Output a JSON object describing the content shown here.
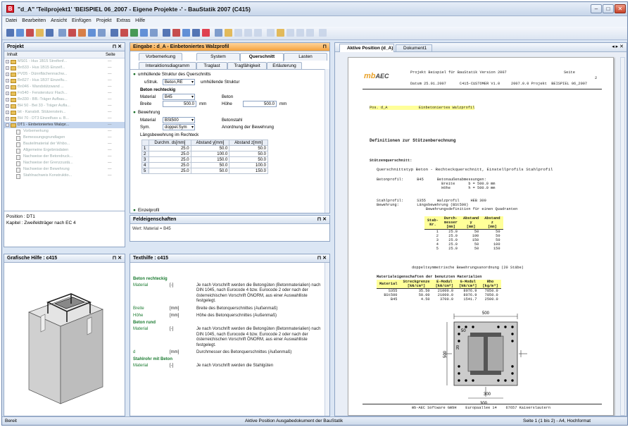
{
  "window": {
    "title": "\"d_A\" 'Teilprojekt1' 'BEISPIEL 06_2007 - Eigene Projekte -' - BauStatik 2007 (C415)",
    "icon": "B"
  },
  "menu": [
    "Datei",
    "Bearbeiten",
    "Ansicht",
    "Einfügen",
    "Projekt",
    "Extras",
    "Hilfe"
  ],
  "project": {
    "title": "Projekt",
    "col_name": "Inhalt",
    "col_page": "Seite",
    "items": [
      {
        "text": "MS01 - Hus 1B15 Streifenf...",
        "level": 0
      },
      {
        "text": "Bn533 - Hus 1B15 Einzelf...",
        "level": 0
      },
      {
        "text": "PVD5 - Dünnflächennachw...",
        "level": 0
      },
      {
        "text": "Bn527 - Hus 1B37 Einzelfu...",
        "level": 0
      },
      {
        "text": "Bn046 - Wandstützwand ...",
        "level": 0
      },
      {
        "text": "Fn540 - Fenstersturz Flach...",
        "level": 0
      },
      {
        "text": "Bn330 - BB.-Träger Aufbau...",
        "level": 0
      },
      {
        "text": "BH 50 - Bei 33 - Träger Aufla...",
        "level": 0
      },
      {
        "text": "bit - Kanalstt. Stützenstein...",
        "level": 0
      },
      {
        "text": "BH 70 - DT3 Einzelfuss u. B...",
        "level": 0
      },
      {
        "text": "DT1 - Einbetoniertes Walzpr...",
        "level": 0
      },
      {
        "text": "Vorbemerkung",
        "level": 1
      },
      {
        "text": "Bemessungsgrundlagen",
        "level": 1
      },
      {
        "text": "Bauteilmaterial der Wnbo...",
        "level": 1
      },
      {
        "text": "Allgemeine Ergebnisdaten",
        "level": 1
      },
      {
        "text": "Nachweise der Betondruck...",
        "level": 1
      },
      {
        "text": "Nachweise der Grenzzustä...",
        "level": 1
      },
      {
        "text": "Nachweise der Bewehrung",
        "level": 1
      },
      {
        "text": "Stahlnachweis Konstruktio...",
        "level": 1
      }
    ],
    "position_lbl": "Position : DT1",
    "kapitel_lbl": "Kapitel : Zweifeldträger nach EC 4"
  },
  "grafische": {
    "title": "Grafische Hilfe : c415"
  },
  "eingabe": {
    "title": "Eingabe : d_A - Einbetoniertes Walzprofil",
    "tabs_top": [
      "Vorbemerkung",
      "System",
      "Querschnitt",
      "Lasten"
    ],
    "tabs_bottom": [
      "Interaktionsdiagramm",
      "Traglast",
      "Tragfähigkeit",
      "Erläuterung"
    ],
    "sect1": "umhüllende Struktur des Querschnitts",
    "ustruk_lbl": "uStruk.",
    "ustruk_val": "Beton,RE",
    "ustruk_desc": "umhüllende Struktur",
    "beton_sect": "Beton rechteckig",
    "material_lbl": "Material",
    "material_val": "B45",
    "material_desc": "Beton",
    "breite_lbl": "Breite",
    "breite_val": "500.0",
    "breite_unit": "mm",
    "hoehe_lbl": "Höhe",
    "hoehe_val": "500.0",
    "hoehe_unit": "mm",
    "bew_sect": "Bewehrung",
    "bmat_lbl": "Material",
    "bmat_val": "BSt500",
    "bmat_desc": "Betonstahl",
    "sym_lbl": "Sym.",
    "sym_val": "doppel.Sym",
    "sym_desc": "Anordnung der Bewehrung",
    "laengs_lbl": "Längsbewehrung im Rechteck",
    "table_headers": [
      "",
      "Durchm. ds[mm]",
      "Abstand y[mm]",
      "Abstand z[mm]"
    ],
    "table_rows": [
      [
        "1",
        "25.0",
        "50.0",
        "50.0"
      ],
      [
        "2",
        "25.0",
        "100.0",
        "50.0"
      ],
      [
        "3",
        "25.0",
        "150.0",
        "50.0"
      ],
      [
        "4",
        "25.0",
        "50.0",
        "100.0"
      ],
      [
        "5",
        "25.0",
        "50.0",
        "150.0"
      ]
    ],
    "einzel_sect": "Einzelprofil"
  },
  "feld": {
    "title": "Feldeigenschaften",
    "value": "Wert: Material = B45"
  },
  "texthilfe": {
    "title": "Texthilfe : c415",
    "entries": [
      {
        "label": "Beton rechteckig",
        "kind": "head"
      },
      {
        "label": "Material",
        "unit": "[-]",
        "text": "Je nach Vorschrift werden die Betongüten (Betonmaterialien) nach DIN 1045, nach Eurocode 4 bzw. Eurocode 2 oder nach der österreichischen Vorschrift ÖNORM, aus einer Auswahlliste festgelegt."
      },
      {
        "label": "Breite",
        "unit": "[mm]",
        "text": "Breite des Betonquerschnittes (Außenmaß)"
      },
      {
        "label": "Höhe",
        "unit": "[mm]",
        "text": "Höhe des Betonquerschnittes (Außenmaß)"
      },
      {
        "label": "Beton rund",
        "kind": "head"
      },
      {
        "label": "Material",
        "unit": "[-]",
        "text": "Je nach Vorschrift werden die Betongüten (Betonmaterialien) nach DIN 1045, nach Eurocode 4 bzw. Eurocode 2 oder nach der österreichischen Vorschrift ÖNORM, aus einer Auswahlliste festgelegt."
      },
      {
        "label": "d",
        "unit": "[mm]",
        "text": "Durchmesser des Betonquerschnittes (Außenmaß)"
      },
      {
        "label": "Stahlrohr mit Beton",
        "kind": "head"
      },
      {
        "label": "Material",
        "unit": "[-]",
        "text": "Je nach Vorschrift werden die Stahlgüten"
      }
    ]
  },
  "aktive": {
    "tab1": "Aktive Position (d_A)",
    "tab2": "Dokument1",
    "header_lines": [
      "Projekt Beispiel für BauStatik Version 2007",
      "Datum 25.01.2007      C415-CUSTOMER V1.0     2007.0.0 Projekt  BEISPIEL 06_2007"
    ],
    "seite_lbl": "Seite",
    "seite_val": "2",
    "pos_line": "Pos. d_A              Einbetoniertes Walzprofil",
    "h1": "Definitionen zur Stützenberechnung",
    "h2": "Stützenquerschnitt:",
    "qline": "Querschnittstyp Beton - Rechteckquerschnitt, Einstellprofils Stahlprofil",
    "betonprofil": "Betonprofil:      B45      Betonaußenabmessungen:\n                             Breite      b = 500.0 mm\n                             Höhe        h = 500.0 mm",
    "stahlprofil": "Stahlprofil:      S355     Walzprofil     HEB 300\nBewehrung:        Längsbewehrung (BSt500)\n                      Bewehrungsdefinition für einen Quadranten",
    "bew_headers": [
      "Stab-\nNr.",
      "Durch-\nmesser\n[mm]",
      "Abstand\ny\n[mm]",
      "Abstand\nz\n[mm]"
    ],
    "bew_rows": [
      [
        "1",
        "25.0",
        "50",
        "50"
      ],
      [
        "2",
        "25.0",
        "100",
        "50"
      ],
      [
        "3",
        "25.0",
        "150",
        "50"
      ],
      [
        "4",
        "25.0",
        "50",
        "100"
      ],
      [
        "5",
        "25.0",
        "50",
        "150"
      ]
    ],
    "doppel": "doppeltsymmetrische Bewehrungsanordnung (20 Stäbe)",
    "mat_title": "Materialeigenschaften der benutzten Materialien",
    "mat_headers": [
      "Material",
      "Streckgrenze\n[kN/cm²]",
      "E-Modul\n[kN/cm²]",
      "G-Modul\n[kN/cm²]",
      "Rho\n[kg/m³]"
    ],
    "mat_rows": [
      [
        "S355",
        "35.50",
        "21000.0",
        "8076.9",
        "7850.0"
      ],
      [
        "BSt500",
        "50.00",
        "21000.0",
        "8076.9",
        "7850.0"
      ],
      [
        "B45",
        "4.50",
        "3700.0",
        "1541.7",
        "2500.0"
      ]
    ],
    "dim_500a": "500",
    "dim_500b": "500",
    "dim_50": "50",
    "dim_20": "20",
    "dim_300": "300",
    "dim_300b": "300",
    "footer": "mb-AEC Software GmbH    Europaallee 14    67657 Kaiserslautern"
  },
  "status": {
    "left": "Bereit",
    "center": "Aktive Position  Ausgabedokument der BauStatik",
    "right": "Seite 1 (1 bis 2) - A4, Hochformat"
  },
  "colors": {
    "accent": "#f3a23e",
    "green": "#136b23",
    "tableyellow": "#ffff99"
  }
}
